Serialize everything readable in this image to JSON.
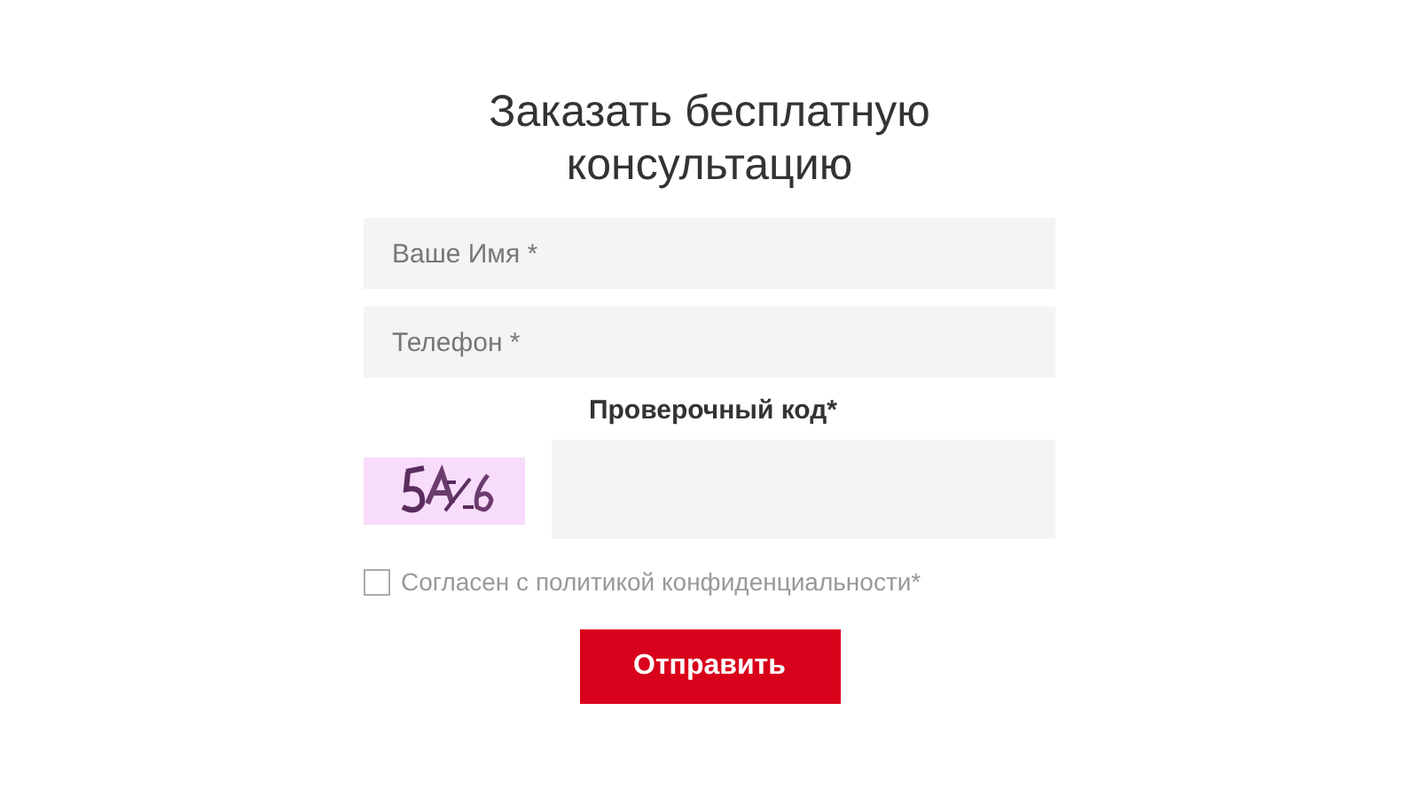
{
  "title": "Заказать бесплатную консультацию",
  "fields": [
    {
      "placeholder": "Ваше Имя *"
    },
    {
      "placeholder": "Телефон *"
    }
  ],
  "captcha": {
    "label": "Проверочный код",
    "required_mark": "*"
  },
  "consent": {
    "label": "Согласен с политикой конфиденциальности",
    "required_mark": "*",
    "checked": false
  },
  "submit": "Отправить"
}
